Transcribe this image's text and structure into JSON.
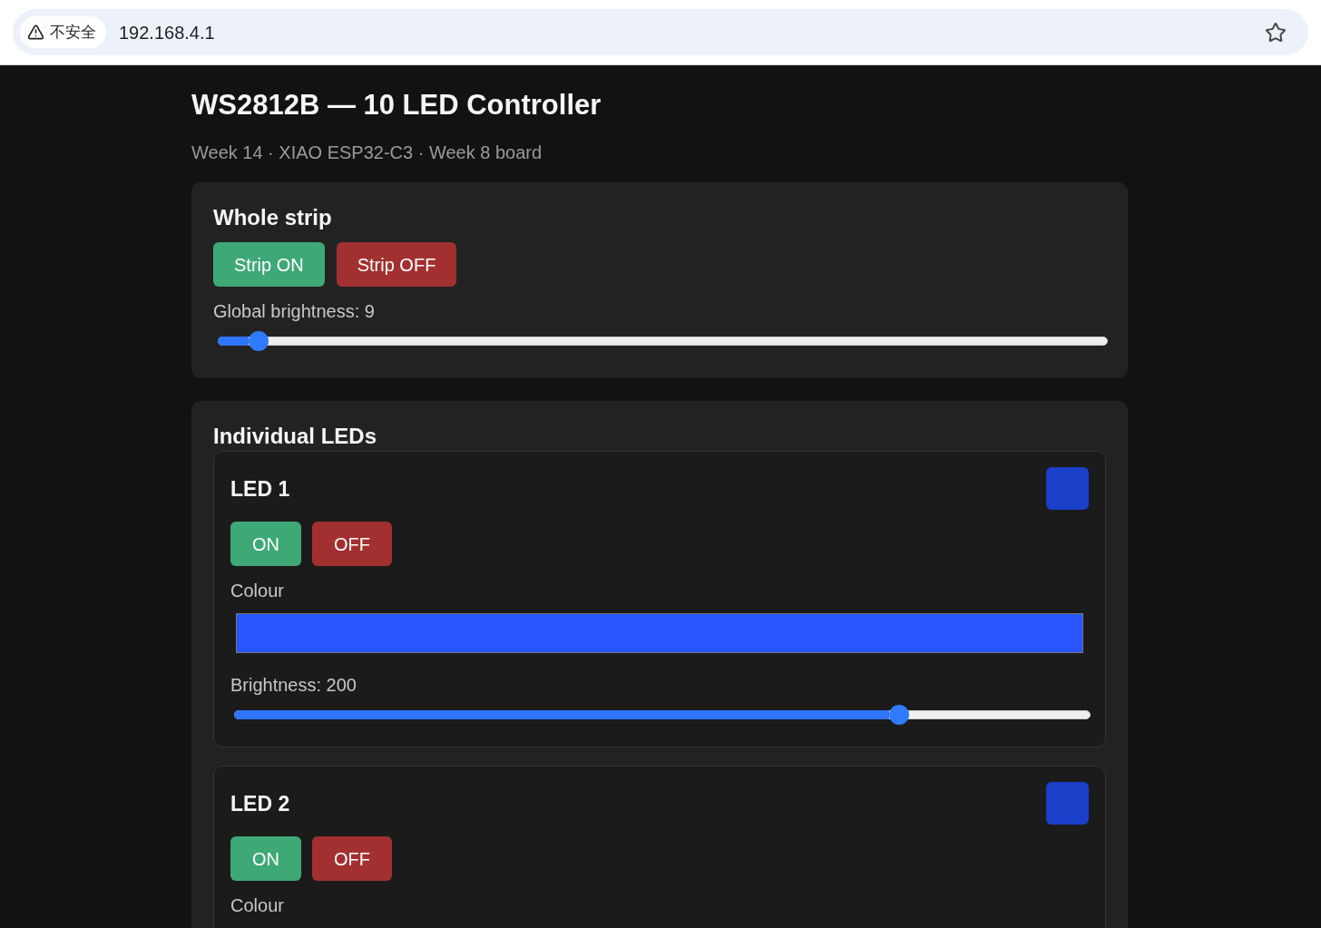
{
  "browser": {
    "security_label": "不安全",
    "url": "192.168.4.1"
  },
  "header": {
    "title": "WS2812B — 10 LED Controller",
    "subtitle": "Week 14 · XIAO ESP32-C3 · Week 8 board"
  },
  "whole_strip": {
    "title": "Whole strip",
    "buttons": [
      {
        "label": "Strip ON",
        "kind": "on"
      },
      {
        "label": "Strip OFF",
        "kind": "off"
      }
    ],
    "brightness": {
      "label": "Global brightness: 9",
      "level": 0.035
    }
  },
  "individual_leds": {
    "title": "Individual LEDs",
    "leds": [
      {
        "name": "LED 1",
        "swatch": {
          "color": "#1a3fc8"
        },
        "buttons": [
          {
            "label": "ON",
            "kind": "on"
          },
          {
            "label": "OFF",
            "kind": "off"
          }
        ],
        "colour_label": "Colour",
        "colour_input": {
          "color": "#2855ff"
        },
        "brightness": {
          "label": "Brightness: 200",
          "level": 0.784
        }
      },
      {
        "name": "LED 2",
        "swatch": {
          "color": "#1a3fc8"
        },
        "buttons": [
          {
            "label": "ON",
            "kind": "on"
          },
          {
            "label": "OFF",
            "kind": "off"
          }
        ],
        "colour_label": "Colour"
      }
    ]
  }
}
